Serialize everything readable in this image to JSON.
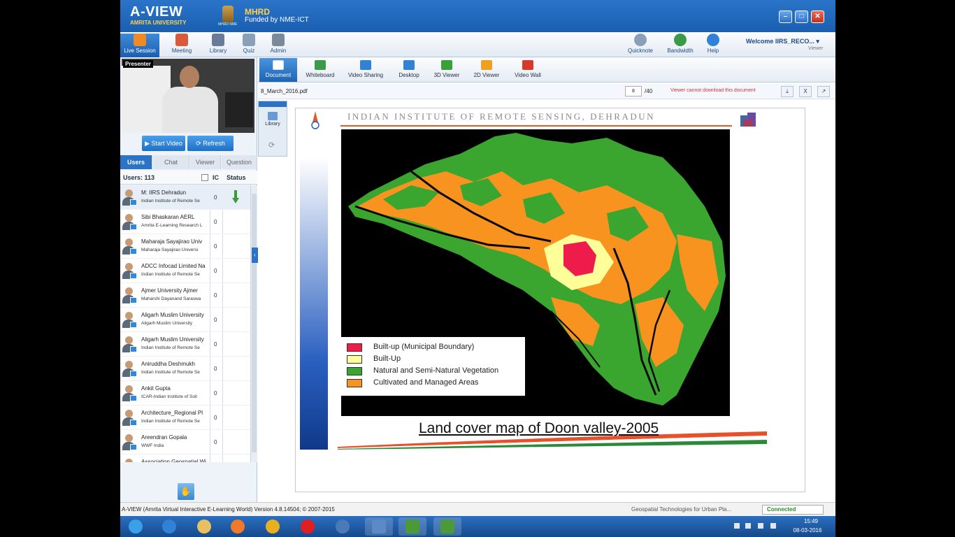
{
  "window": {
    "logo_main": "A-VIEW",
    "logo_sub": "AMRITA UNIVERSITY",
    "mhrd": "MHRD",
    "funded": "Funded by NME-ICT",
    "emblem_text": "MHRD NME",
    "min_symbol": "–",
    "max_symbol": "□",
    "close_symbol": "✕"
  },
  "toolbar": {
    "items": [
      {
        "label": "Live Session",
        "icon": "live-session-icon",
        "color": "#f08a24",
        "active": true
      },
      {
        "label": "Meeting",
        "icon": "meeting-icon",
        "color": "#d85a3a"
      },
      {
        "label": "Library",
        "icon": "library-icon",
        "color": "#6a7a9a"
      },
      {
        "label": "Quiz",
        "icon": "quiz-icon",
        "color": "#8aa0b8"
      },
      {
        "label": "Admin",
        "icon": "admin-icon",
        "color": "#7a8a9a"
      }
    ],
    "right_items": [
      {
        "label": "Quicknote",
        "icon": "quicknote-icon",
        "color": "#8aa0b8"
      },
      {
        "label": "Bandwidth",
        "icon": "bandwidth-icon",
        "color": "#3a9a4a"
      },
      {
        "label": "Help",
        "icon": "help-icon",
        "color": "#2f82d6"
      }
    ],
    "welcome": "Welcome IIRS_RECO...",
    "role": "Viewer"
  },
  "left": {
    "presenter_tag": "Presenter",
    "start_video": "Start Video",
    "refresh": "Refresh",
    "tabs": [
      "Users",
      "Chat",
      "Viewer",
      "Question"
    ],
    "users_count": "Users: 113",
    "col_ic": "IC",
    "col_status": "Status",
    "users": [
      {
        "name": "M: IIRS Dehradun",
        "org": "Indian Institute of Remote Se",
        "ic": "0",
        "status": "presenting"
      },
      {
        "name": "Sibi Bhaskaran AERL",
        "org": "Amrita E-Learning Research L",
        "ic": "0"
      },
      {
        "name": "Maharaja Sayajirao Univ",
        "org": "Maharaja Sayajirao Universi",
        "ic": "0"
      },
      {
        "name": "ADCC Infocad Limited Na",
        "org": "Indian Institute of Remote Se",
        "ic": "0"
      },
      {
        "name": "Ajmer University Ajmer",
        "org": "Maharshi Dayanand Saraswa",
        "ic": "0"
      },
      {
        "name": "Aligarh Muslim University",
        "org": "Aligarh Muslim University",
        "ic": "0"
      },
      {
        "name": "Aligarh Muslim University",
        "org": "Indian Institute of Remote Se",
        "ic": "0"
      },
      {
        "name": "Aniruddha Deshmukh",
        "org": "Indian Institute of Remote Se",
        "ic": "0"
      },
      {
        "name": "Ankit Gupta",
        "org": "ICAR-Indian Institute of Soil",
        "ic": "0"
      },
      {
        "name": "Architecture_Regional Pl",
        "org": "Indian Institute of Remote Se",
        "ic": "0"
      },
      {
        "name": "Areendran Gopala",
        "org": "WWF India",
        "ic": "0"
      },
      {
        "name": "Association Geospatial Wi",
        "org": "",
        "ic": ""
      }
    ],
    "raise_hand": "✋",
    "collapse": "‹"
  },
  "content": {
    "modules": [
      {
        "label": "Document",
        "icon": "document-icon",
        "color": "#ffffff",
        "active": true
      },
      {
        "label": "Whiteboard",
        "icon": "whiteboard-icon",
        "color": "#3a9a4a"
      },
      {
        "label": "Video Sharing",
        "icon": "video-sharing-icon",
        "color": "#2f82d6"
      },
      {
        "label": "Desktop",
        "icon": "desktop-icon",
        "color": "#2f82d6"
      },
      {
        "label": "3D Viewer",
        "icon": "3d-viewer-icon",
        "color": "#3aa03a"
      },
      {
        "label": "2D Viewer",
        "icon": "2d-viewer-icon",
        "color": "#f0a020"
      },
      {
        "label": "Video Wall",
        "icon": "video-wall-icon",
        "color": "#d83a2a"
      }
    ],
    "doc_name": "8_March_2016.pdf",
    "page_current": "8",
    "page_total": "/40",
    "doc_notice": "Viewer cannot download this document",
    "doc_download": "⤓",
    "doc_close": "X",
    "doc_expand": "↗",
    "library_label": "Library",
    "sync_symbol": "⟳"
  },
  "slide": {
    "header": "INDIAN INSTITUTE OF REMOTE SENSING, DEHRADUN",
    "caption": "Land cover map of Doon valley-2005",
    "legend": [
      {
        "label": "Built-up (Municipal Boundary)",
        "color": "#ee1c4a"
      },
      {
        "label": "Built-Up",
        "color": "#ffff99"
      },
      {
        "label": "Natural and Semi-Natural Vegetation",
        "color": "#3aa630"
      },
      {
        "label": "Cultivated and Managed Areas",
        "color": "#f7931e"
      }
    ]
  },
  "status": {
    "version": "A-VIEW (Amrita Virtual Interactive E-Learning World) Version 4.8.14504; © 2007-2015",
    "session": "Geospatial Technologies for Urban Pla...",
    "connection": "Connected"
  },
  "taskbar": {
    "time": "15:49",
    "date": "08-03-2016",
    "apps": [
      {
        "icon": "start-icon",
        "color": "#3aa0e8"
      },
      {
        "icon": "internet-explorer-icon",
        "color": "#2f82d6"
      },
      {
        "icon": "file-explorer-icon",
        "color": "#e8c060"
      },
      {
        "icon": "media-player-icon",
        "color": "#f07a2a"
      },
      {
        "icon": "chrome-icon",
        "color": "#e8b020"
      },
      {
        "icon": "opera-icon",
        "color": "#e02020"
      },
      {
        "icon": "bird-app-icon",
        "color": "#4a7ab8"
      },
      {
        "icon": "a-view-taskbar-icon",
        "color": "#5a8ac8"
      },
      {
        "icon": "camtasia-icon",
        "color": "#4a9a3a"
      },
      {
        "icon": "camtasia-recorder-icon",
        "color": "#4a9a3a"
      }
    ]
  }
}
